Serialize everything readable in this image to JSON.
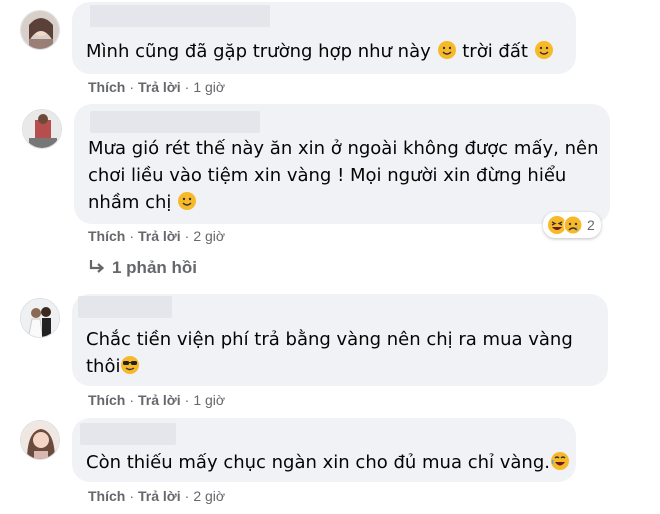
{
  "comments": [
    {
      "text": "Mình cũng đã gặp trường hợp như này",
      "text_tail": "trời đất",
      "actions": {
        "like": "Thích",
        "reply": "Trả lời",
        "time": "1 giờ"
      }
    },
    {
      "line1": "Mưa gió rét thế này ăn xin ở ngoài không được mấy, nên",
      "line2": "chơi liều vào tiệm xin vàng ! Mọi người xin đừng hiểu",
      "line3": "nhầm chị",
      "reaction_count": "2",
      "actions": {
        "like": "Thích",
        "reply": "Trả lời",
        "time": "2 giờ"
      },
      "replies_label": "1 phản hồi"
    },
    {
      "line1": "Chắc tiền viện phí trả bằng vàng nên chị ra mua vàng",
      "line2": "thôi",
      "actions": {
        "like": "Thích",
        "reply": "Trả lời",
        "time": "1 giờ"
      }
    },
    {
      "line1": "Còn thiếu mấy chục ngàn xin cho đủ mua chỉ vàng.",
      "actions": {
        "like": "Thích",
        "reply": "Trả lời",
        "time": "2 giờ"
      }
    }
  ],
  "colors": {
    "bubble": "#f0f2f5",
    "meta": "#65676b",
    "text": "#050505"
  }
}
